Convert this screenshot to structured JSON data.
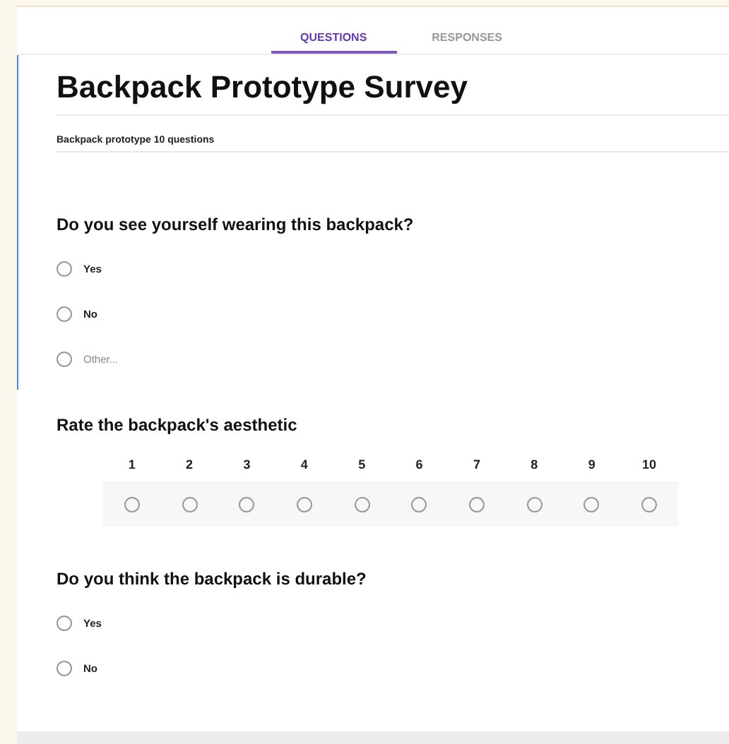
{
  "tabs": [
    {
      "label": "QUESTIONS",
      "selected": true
    },
    {
      "label": "RESPONSES",
      "selected": false
    }
  ],
  "form": {
    "title": "Backpack Prototype Survey",
    "description": "Backpack prototype 10 questions",
    "focused": true
  },
  "questions": [
    {
      "kind": "choice",
      "title": "Do you see yourself wearing this backpack?",
      "focused": true,
      "options": [
        {
          "label": "Yes",
          "kind": "option",
          "selected": false
        },
        {
          "label": "No",
          "kind": "option",
          "selected": false
        },
        {
          "label": "Other...",
          "kind": "other",
          "selected": false
        }
      ]
    },
    {
      "kind": "scale",
      "title": "Rate the backpack's aesthetic",
      "focused": false,
      "scale": [
        {
          "label": "1",
          "selected": false
        },
        {
          "label": "2",
          "selected": false
        },
        {
          "label": "3",
          "selected": false
        },
        {
          "label": "4",
          "selected": false
        },
        {
          "label": "5",
          "selected": false
        },
        {
          "label": "6",
          "selected": false
        },
        {
          "label": "7",
          "selected": false
        },
        {
          "label": "8",
          "selected": false
        },
        {
          "label": "9",
          "selected": false
        },
        {
          "label": "10",
          "selected": false
        }
      ]
    },
    {
      "kind": "choice",
      "title": "Do you think the backpack is durable?",
      "focused": false,
      "options": [
        {
          "label": "Yes",
          "kind": "option",
          "selected": false
        },
        {
          "label": "No",
          "kind": "option",
          "selected": false
        }
      ]
    }
  ]
}
